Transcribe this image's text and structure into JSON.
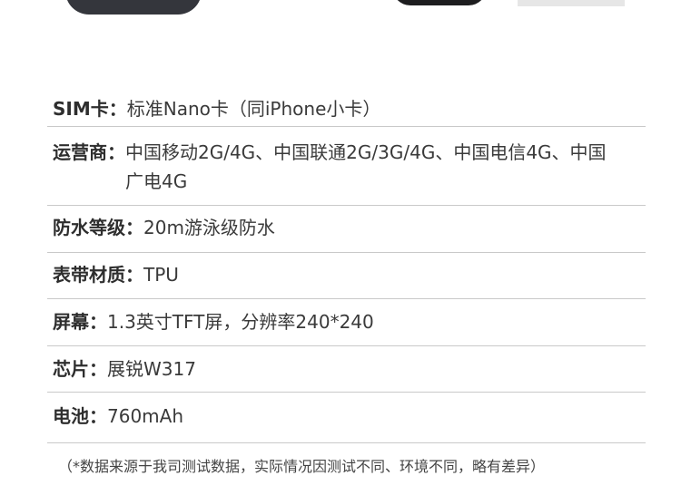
{
  "specs": [
    {
      "label": "SIM卡：",
      "value": "标准Nano卡（同iPhone小卡）"
    },
    {
      "label": "运营商：",
      "value": "中国移动2G/4G、中国联通2G/3G/4G、中国电信4G、中国广电4G"
    },
    {
      "label": "防水等级：",
      "value": "20m游泳级防水"
    },
    {
      "label": "表带材质：",
      "value": "TPU"
    },
    {
      "label": "屏幕：",
      "value": "1.3英寸TFT屏，分辨率240*240"
    },
    {
      "label": "芯片：",
      "value": "展锐W317"
    },
    {
      "label": "电池：",
      "value": "760mAh"
    }
  ],
  "note": "（*数据来源于我司测试数据，实际情况因测试不同、环境不同，略有差异）"
}
